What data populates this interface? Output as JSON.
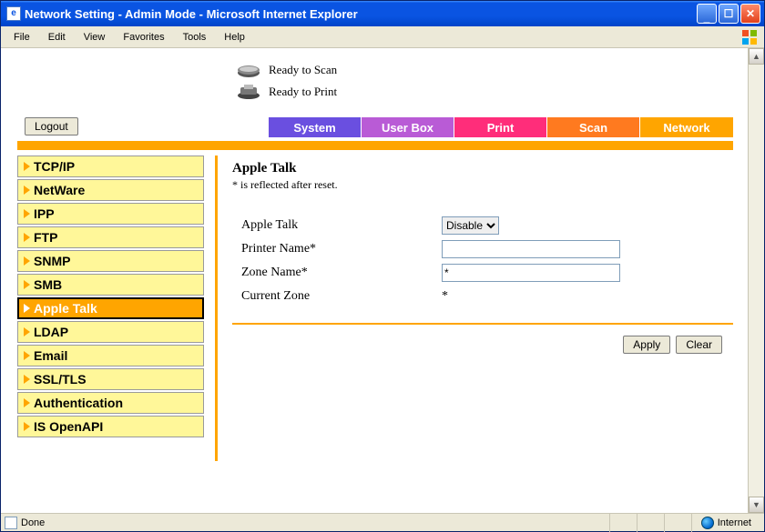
{
  "window_title": "Network Setting - Admin Mode - Microsoft Internet Explorer",
  "menus": {
    "file": "File",
    "edit": "Edit",
    "view": "View",
    "favorites": "Favorites",
    "tools": "Tools",
    "help": "Help"
  },
  "status": {
    "scan": "Ready to Scan",
    "print": "Ready to Print"
  },
  "logout": "Logout",
  "tabs": {
    "system": "System",
    "userbox": "User Box",
    "print": "Print",
    "scan": "Scan",
    "network": "Network"
  },
  "sidebar": {
    "items": [
      {
        "label": "TCP/IP"
      },
      {
        "label": "NetWare"
      },
      {
        "label": "IPP"
      },
      {
        "label": "FTP"
      },
      {
        "label": "SNMP"
      },
      {
        "label": "SMB"
      },
      {
        "label": "Apple Talk"
      },
      {
        "label": "LDAP"
      },
      {
        "label": "Email"
      },
      {
        "label": "SSL/TLS"
      },
      {
        "label": "Authentication"
      },
      {
        "label": "IS OpenAPI"
      }
    ],
    "selected_index": 6
  },
  "panel": {
    "heading": "Apple Talk",
    "note": "* is reflected after reset.",
    "fields": {
      "appletalk_label": "Apple Talk",
      "appletalk_value": "Disable",
      "printer_label": "Printer Name*",
      "printer_value": "",
      "zone_label": "Zone Name*",
      "zone_value": "*",
      "currzone_label": "Current Zone",
      "currzone_value": "*"
    },
    "apply": "Apply",
    "clear": "Clear"
  },
  "statusbar": {
    "done": "Done",
    "zone": "Internet"
  }
}
